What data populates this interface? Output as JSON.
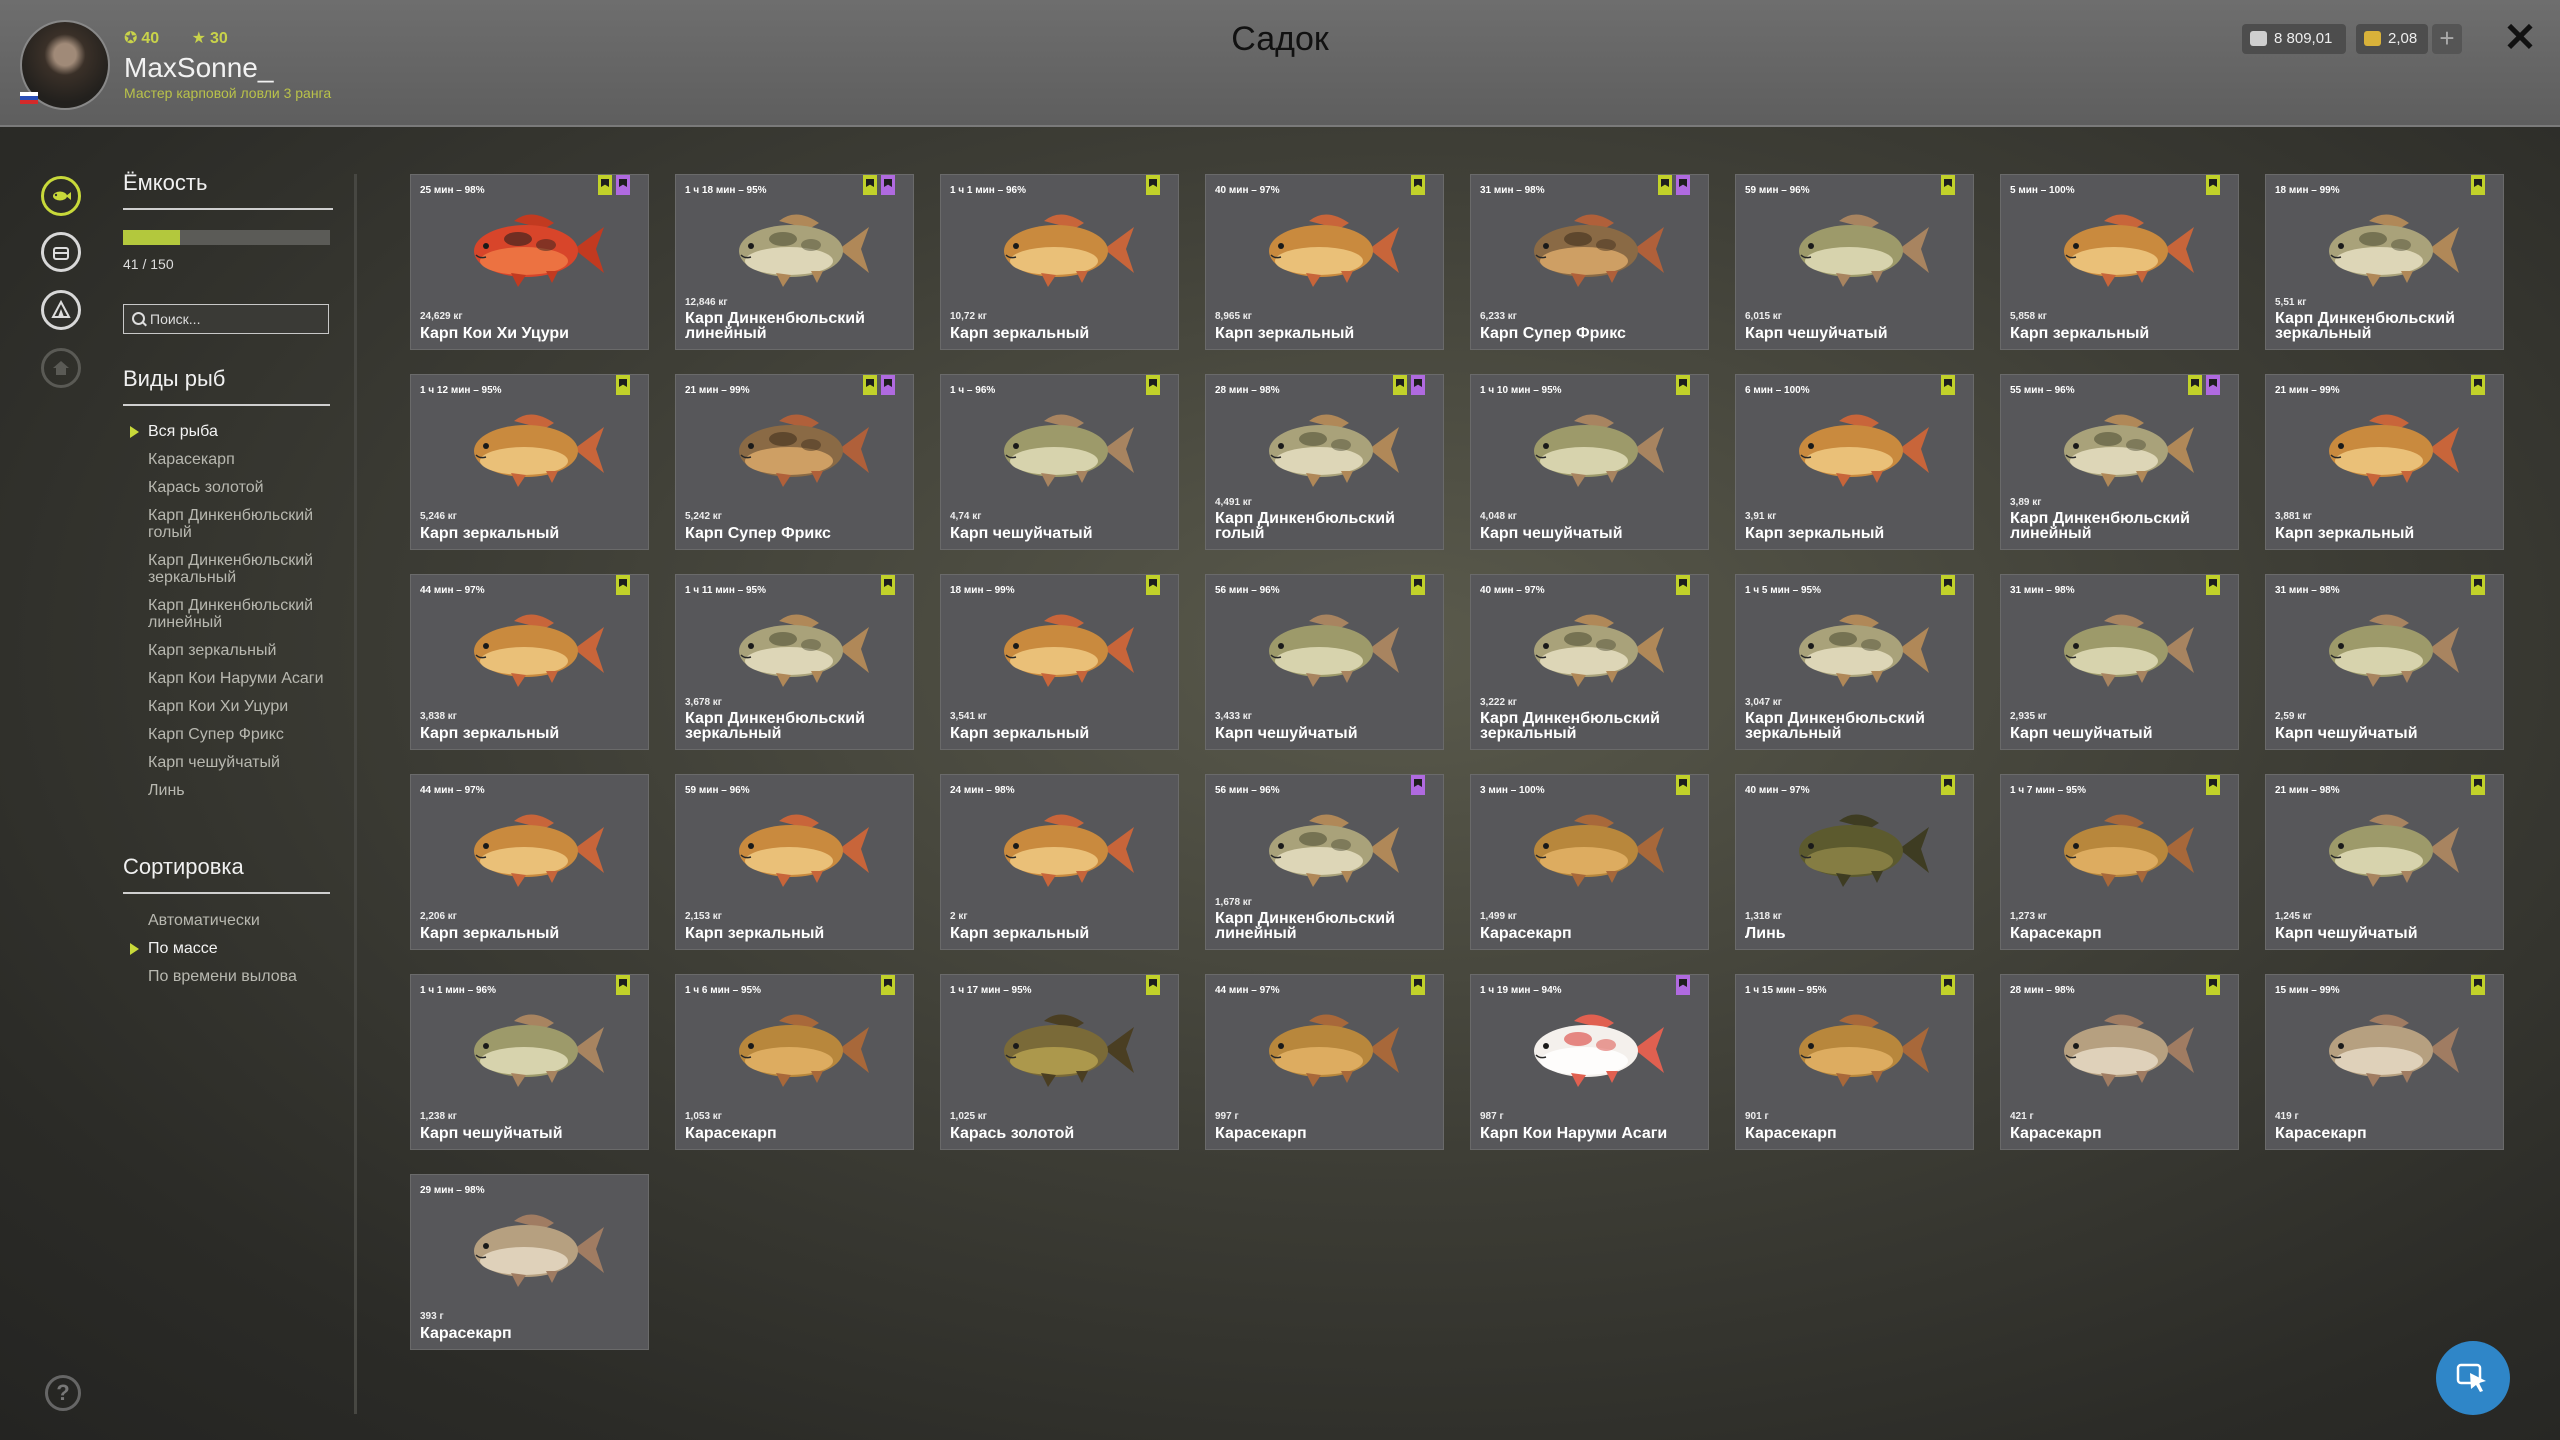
{
  "header": {
    "title": "Садок",
    "username": "MaxSonne_",
    "rank": "Мастер карповой ловли 3 ранга",
    "level": "40",
    "stars": "30",
    "silver": "8 809,01",
    "gold": "2,08"
  },
  "capacity": {
    "title": "Ёмкость",
    "text": "41 / 150",
    "fraction": 0.273
  },
  "search": {
    "placeholder": "Поиск..."
  },
  "species": {
    "title": "Виды рыб",
    "items": [
      "Вся рыба",
      "Карасекарп",
      "Карась золотой",
      "Карп Динкенбюльский голый",
      "Карп Динкенбюльский зеркальный",
      "Карп Динкенбюльский линейный",
      "Карп зеркальный",
      "Карп Кои Наруми Асаги",
      "Карп Кои Хи Уцури",
      "Карп Супер Фрикс",
      "Карп чешуйчатый",
      "Линь"
    ],
    "selected": 0
  },
  "sort": {
    "title": "Сортировка",
    "items": [
      "Автоматически",
      "По массе",
      "По времени вылова"
    ],
    "selected": 1
  },
  "colors": {
    "accent": "#c1d12a",
    "tag_purple": "#b06ae0"
  },
  "fish": [
    {
      "time": "25 мин – 98%",
      "weight": "24,629 кг",
      "name": "Карп Кои Хи Уцури",
      "tags": [
        "g",
        "p"
      ],
      "kind": "koi_red"
    },
    {
      "time": "1 ч 18 мин – 95%",
      "weight": "12,846 кг",
      "name": "Карп Динкенбюльский линейный",
      "tags": [
        "g",
        "p"
      ],
      "kind": "dink"
    },
    {
      "time": "1 ч 1 мин – 96%",
      "weight": "10,72 кг",
      "name": "Карп зеркальный",
      "tags": [
        "g"
      ],
      "kind": "mirror"
    },
    {
      "time": "40 мин – 97%",
      "weight": "8,965 кг",
      "name": "Карп зеркальный",
      "tags": [
        "g"
      ],
      "kind": "mirror"
    },
    {
      "time": "31 мин – 98%",
      "weight": "6,233 кг",
      "name": "Карп Супер Фрикс",
      "tags": [
        "g",
        "p"
      ],
      "kind": "frix"
    },
    {
      "time": "59 мин – 96%",
      "weight": "6,015 кг",
      "name": "Карп чешуйчатый",
      "tags": [
        "g"
      ],
      "kind": "common"
    },
    {
      "time": "5 мин – 100%",
      "weight": "5,858 кг",
      "name": "Карп зеркальный",
      "tags": [
        "g"
      ],
      "kind": "mirror"
    },
    {
      "time": "18 мин – 99%",
      "weight": "5,51 кг",
      "name": "Карп Динкенбюльский зеркальный",
      "tags": [
        "g"
      ],
      "kind": "dink"
    },
    {
      "time": "1 ч 12 мин – 95%",
      "weight": "5,246 кг",
      "name": "Карп зеркальный",
      "tags": [
        "g"
      ],
      "kind": "mirror"
    },
    {
      "time": "21 мин – 99%",
      "weight": "5,242 кг",
      "name": "Карп Супер Фрикс",
      "tags": [
        "g",
        "p"
      ],
      "kind": "frix"
    },
    {
      "time": "1 ч – 96%",
      "weight": "4,74 кг",
      "name": "Карп чешуйчатый",
      "tags": [
        "g"
      ],
      "kind": "common"
    },
    {
      "time": "28 мин – 98%",
      "weight": "4,491 кг",
      "name": "Карп Динкенбюльский голый",
      "tags": [
        "g",
        "p"
      ],
      "kind": "dink"
    },
    {
      "time": "1 ч 10 мин – 95%",
      "weight": "4,048 кг",
      "name": "Карп чешуйчатый",
      "tags": [
        "g"
      ],
      "kind": "common"
    },
    {
      "time": "6 мин – 100%",
      "weight": "3,91 кг",
      "name": "Карп зеркальный",
      "tags": [
        "g"
      ],
      "kind": "mirror"
    },
    {
      "time": "55 мин – 96%",
      "weight": "3,89 кг",
      "name": "Карп Динкенбюльский линейный",
      "tags": [
        "g",
        "p"
      ],
      "kind": "dink"
    },
    {
      "time": "21 мин – 99%",
      "weight": "3,881 кг",
      "name": "Карп зеркальный",
      "tags": [
        "g"
      ],
      "kind": "mirror"
    },
    {
      "time": "44 мин – 97%",
      "weight": "3,838 кг",
      "name": "Карп зеркальный",
      "tags": [
        "g"
      ],
      "kind": "mirror"
    },
    {
      "time": "1 ч 11 мин – 95%",
      "weight": "3,678 кг",
      "name": "Карп Динкенбюльский зеркальный",
      "tags": [
        "g"
      ],
      "kind": "dink"
    },
    {
      "time": "18 мин – 99%",
      "weight": "3,541 кг",
      "name": "Карп зеркальный",
      "tags": [
        "g"
      ],
      "kind": "mirror"
    },
    {
      "time": "56 мин – 96%",
      "weight": "3,433 кг",
      "name": "Карп чешуйчатый",
      "tags": [
        "g"
      ],
      "kind": "common"
    },
    {
      "time": "40 мин – 97%",
      "weight": "3,222 кг",
      "name": "Карп Динкенбюльский зеркальный",
      "tags": [
        "g"
      ],
      "kind": "dink"
    },
    {
      "time": "1 ч 5 мин – 95%",
      "weight": "3,047 кг",
      "name": "Карп Динкенбюльский зеркальный",
      "tags": [
        "g"
      ],
      "kind": "dink"
    },
    {
      "time": "31 мин – 98%",
      "weight": "2,935 кг",
      "name": "Карп чешуйчатый",
      "tags": [
        "g"
      ],
      "kind": "common"
    },
    {
      "time": "31 мин – 98%",
      "weight": "2,59 кг",
      "name": "Карп чешуйчатый",
      "tags": [
        "g"
      ],
      "kind": "common"
    },
    {
      "time": "44 мин – 97%",
      "weight": "2,206 кг",
      "name": "Карп зеркальный",
      "tags": [],
      "kind": "mirror"
    },
    {
      "time": "59 мин – 96%",
      "weight": "2,153 кг",
      "name": "Карп зеркальный",
      "tags": [],
      "kind": "mirror"
    },
    {
      "time": "24 мин – 98%",
      "weight": "2 кг",
      "name": "Карп зеркальный",
      "tags": [],
      "kind": "mirror"
    },
    {
      "time": "56 мин – 96%",
      "weight": "1,678 кг",
      "name": "Карп Динкенбюльский линейный",
      "tags": [
        "p"
      ],
      "kind": "dink"
    },
    {
      "time": "3 мин – 100%",
      "weight": "1,499 кг",
      "name": "Карасекарп",
      "tags": [
        "g"
      ],
      "kind": "hybrid"
    },
    {
      "time": "40 мин – 97%",
      "weight": "1,318 кг",
      "name": "Линь",
      "tags": [
        "g"
      ],
      "kind": "tench"
    },
    {
      "time": "1 ч 7 мин – 95%",
      "weight": "1,273 кг",
      "name": "Карасекарп",
      "tags": [
        "g"
      ],
      "kind": "hybrid"
    },
    {
      "time": "21 мин – 98%",
      "weight": "1,245 кг",
      "name": "Карп чешуйчатый",
      "tags": [
        "g"
      ],
      "kind": "common"
    },
    {
      "time": "1 ч 1 мин – 96%",
      "weight": "1,238 кг",
      "name": "Карп чешуйчатый",
      "tags": [
        "g"
      ],
      "kind": "common"
    },
    {
      "time": "1 ч 6 мин – 95%",
      "weight": "1,053 кг",
      "name": "Карасекарп",
      "tags": [
        "g"
      ],
      "kind": "hybrid"
    },
    {
      "time": "1 ч 17 мин – 95%",
      "weight": "1,025 кг",
      "name": "Карась золотой",
      "tags": [
        "g"
      ],
      "kind": "crucian"
    },
    {
      "time": "44 мин – 97%",
      "weight": "997 г",
      "name": "Карасекарп",
      "tags": [
        "g"
      ],
      "kind": "hybrid"
    },
    {
      "time": "1 ч 19 мин – 94%",
      "weight": "987 г",
      "name": "Карп Кои Наруми Асаги",
      "tags": [
        "p"
      ],
      "kind": "koi_white"
    },
    {
      "time": "1 ч 15 мин – 95%",
      "weight": "901 г",
      "name": "Карасекарп",
      "tags": [
        "g"
      ],
      "kind": "hybrid"
    },
    {
      "time": "28 мин – 98%",
      "weight": "421 г",
      "name": "Карасекарп",
      "tags": [
        "g"
      ],
      "kind": "hybrid_pale"
    },
    {
      "time": "15 мин – 99%",
      "weight": "419 г",
      "name": "Карасекарп",
      "tags": [
        "g"
      ],
      "kind": "hybrid_pale"
    },
    {
      "time": "29 мин – 98%",
      "weight": "393 г",
      "name": "Карасекарп",
      "tags": [],
      "kind": "hybrid_pale"
    }
  ]
}
